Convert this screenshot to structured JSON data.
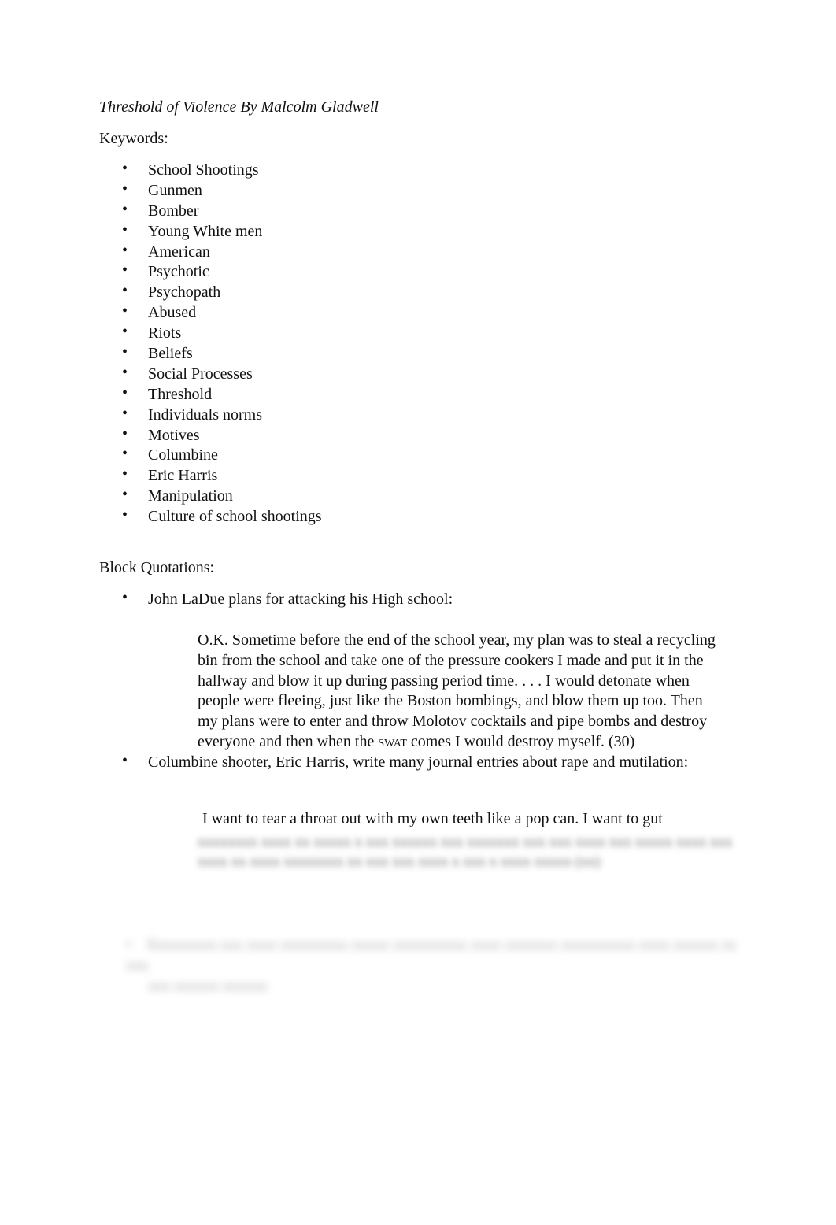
{
  "document": {
    "title": "Threshold of Violence By Malcolm Gladwell",
    "keywords_heading": "Keywords:",
    "keywords": [
      "School Shootings",
      "Gunmen",
      "Bomber",
      "Young White men",
      "American",
      "Psychotic",
      "Psychopath",
      "Abused",
      "Riots",
      "Beliefs",
      "Social Processes",
      "Threshold",
      "Individuals norms",
      "Motives",
      "Columbine",
      "Eric Harris",
      "Manipulation",
      "Culture of school shootings"
    ],
    "block_quotations_heading": "Block Quotations:",
    "bullet_glyph": "•",
    "quotations": [
      {
        "intro": "John LaDue plans for attacking his High school:",
        "quote_lines": [
          "O.K. Sometime before the end of the school year, my plan was to steal a recycling",
          "bin from the school and take one of the pressure cookers I made and put it in the",
          "hallway and blow it up during passing period time. . . . I would detonate when",
          "people were fleeing, just like the Boston bombings, and blow them up too. Then",
          "my plans were to enter and throw Molotov cocktails and pipe bombs and destroy"
        ],
        "last_line_before": "everyone and then when the ",
        "last_line_smallcaps": "SWAT",
        "last_line_after": " comes I would destroy myself. (30)"
      },
      {
        "intro": "Columbine shooter, Eric Harris, write many journal entries about rape and mutilation:",
        "quote_visible": "I want to tear a throat out with my own teeth like a pop can. I want to gut",
        "quote_blurred_lines": [
          "xxxxxxxx xxxx xx xxxxx x xxx xxxxxx xxx xxxxxxx xxx xxx xxxx xxx xxxxx xxxx xxx",
          "xxxx xx xxxx xxxxxxxx xx xxx xxx xxxx x xxx x xxxx xxxxx (xx)"
        ]
      }
    ],
    "blurred_bullet_lines": [
      "Xxxxxxxxx xxx xxxx xxxxxxxxx xxxxx xxxxxxxxxx xxxx xxxxxxx xxxxxxxxxx xxxx xxxxxx xx xxx",
      "xxx xxxxxx xxxxxx"
    ]
  }
}
